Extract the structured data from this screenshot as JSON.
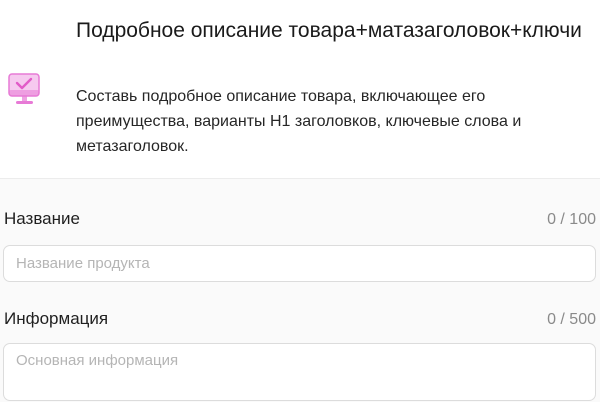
{
  "header": {
    "icon": "monitor-check-icon",
    "title": "Подробное описание товара+матазаголовок+ключи",
    "description": "Составь подробное описание товара, включающее его преимущества, варианты H1 заголовков, ключевые слова и метазаголовок."
  },
  "form": {
    "name_field": {
      "label": "Название",
      "counter": "0 / 100",
      "placeholder": "Название продукта",
      "value": ""
    },
    "info_field": {
      "label": "Информация",
      "counter": "0 / 500",
      "placeholder": "Основная информация",
      "value": ""
    }
  },
  "colors": {
    "icon_pink": "#e77ad6",
    "icon_light": "#f6c9ef",
    "form_background": "#fafafa",
    "placeholder": "#b5b5b5"
  }
}
